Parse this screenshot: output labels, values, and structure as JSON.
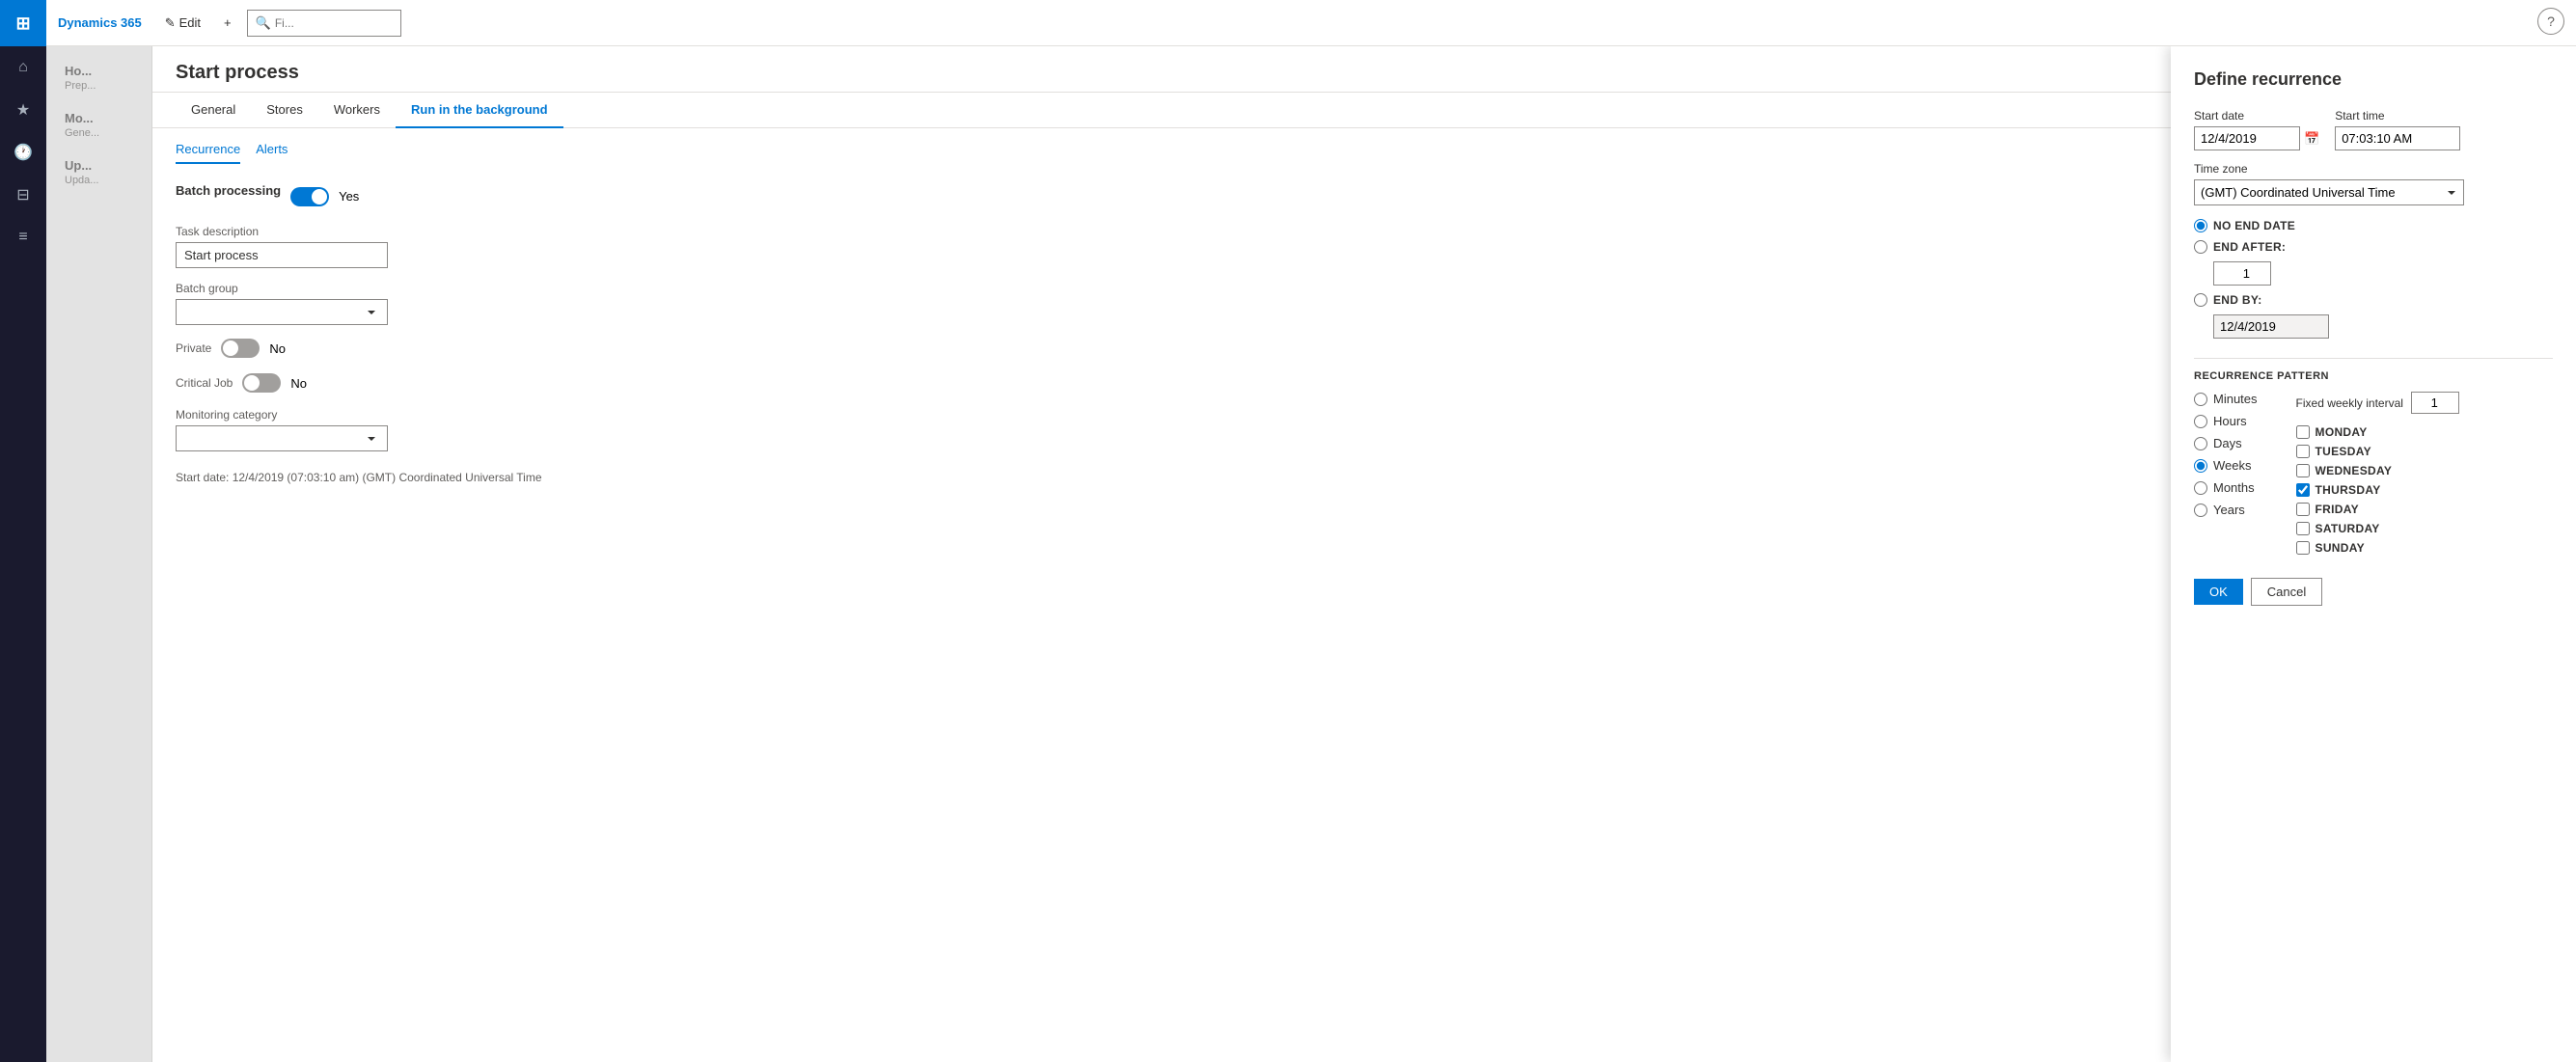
{
  "app": {
    "brand": "Dynamics 365"
  },
  "toolbar": {
    "edit_label": "Edit",
    "new_label": "+",
    "search_placeholder": "Fi..."
  },
  "nav_icons": [
    "⊞",
    "★",
    "🕐",
    "⊟",
    "≡"
  ],
  "panel": {
    "title": "Start process",
    "tabs": [
      "General",
      "Stores",
      "Workers",
      "Run in the background"
    ],
    "active_tab": "Run in the background",
    "sub_tabs": [
      "Recurrence",
      "Alerts"
    ],
    "active_sub_tab": "Recurrence",
    "batch_section": "Batch processing",
    "batch_toggle": "Yes",
    "task_description_label": "Task description",
    "task_description_value": "Start process",
    "batch_group_label": "Batch group",
    "batch_group_value": "",
    "private_label": "Private",
    "private_toggle": "No",
    "critical_job_label": "Critical Job",
    "critical_job_toggle": "No",
    "monitoring_category_label": "Monitoring category",
    "monitoring_category_value": "",
    "start_date_info": "Start date: 12/4/2019 (07:03:10 am) (GMT) Coordinated Universal Time"
  },
  "recurrence": {
    "title": "Define recurrence",
    "start_date_label": "Start date",
    "start_date_value": "12/4/2019",
    "start_time_label": "Start time",
    "start_time_value": "07:03:10 AM",
    "timezone_label": "Time zone",
    "timezone_value": "(GMT) Coordinated Universal Time",
    "end_options": [
      {
        "id": "no_end",
        "label": "NO END DATE",
        "selected": true
      },
      {
        "id": "end_after",
        "label": "END AFTER:",
        "selected": false
      },
      {
        "id": "end_by",
        "label": "END BY:",
        "selected": false
      }
    ],
    "end_after_value": "1",
    "end_by_value": "12/4/2019",
    "recurrence_pattern_heading": "RECURRENCE PATTERN",
    "pattern_options": [
      {
        "id": "minutes",
        "label": "Minutes",
        "selected": false
      },
      {
        "id": "hours",
        "label": "Hours",
        "selected": false
      },
      {
        "id": "days",
        "label": "Days",
        "selected": false
      },
      {
        "id": "weeks",
        "label": "Weeks",
        "selected": true
      },
      {
        "id": "months",
        "label": "Months",
        "selected": false
      },
      {
        "id": "years",
        "label": "Years",
        "selected": false
      }
    ],
    "fixed_weekly_interval_label": "Fixed weekly interval",
    "fixed_weekly_interval_value": "1",
    "days_of_week": [
      {
        "id": "monday",
        "label": "MONDAY",
        "checked": false
      },
      {
        "id": "tuesday",
        "label": "TUESDAY",
        "checked": false
      },
      {
        "id": "wednesday",
        "label": "WEDNESDAY",
        "checked": false
      },
      {
        "id": "thursday",
        "label": "THURSDAY",
        "checked": true
      },
      {
        "id": "friday",
        "label": "FRIDAY",
        "checked": false
      },
      {
        "id": "saturday",
        "label": "SATURDAY",
        "checked": false
      },
      {
        "id": "sunday",
        "label": "SUNDAY",
        "checked": false
      }
    ],
    "ok_label": "OK",
    "cancel_label": "Cancel"
  },
  "left_items": [
    {
      "title": "Ho...",
      "sub": "Prep..."
    },
    {
      "title": "Mo...",
      "sub": "Gene..."
    },
    {
      "title": "Up...",
      "sub": "Upda..."
    }
  ]
}
